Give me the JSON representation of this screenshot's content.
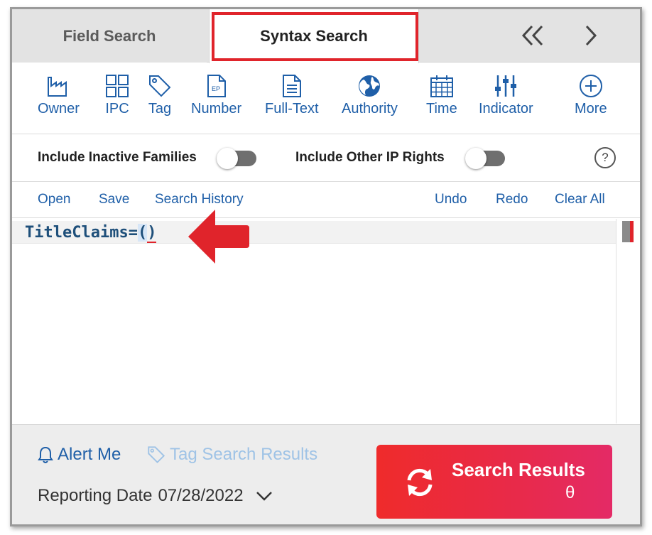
{
  "tabs": {
    "field_search": "Field Search",
    "syntax_search": "Syntax Search",
    "prev_icon": "double-chevron-left",
    "next_icon": "chevron-right"
  },
  "tools": [
    {
      "label": "Owner",
      "icon": "factory-icon"
    },
    {
      "label": "IPC",
      "icon": "grid-icon"
    },
    {
      "label": "Tag",
      "icon": "tag-icon"
    },
    {
      "label": "Number",
      "icon": "ep-document-icon"
    },
    {
      "label": "Full-Text",
      "icon": "document-icon"
    },
    {
      "label": "Authority",
      "icon": "globe-icon"
    },
    {
      "label": "Time",
      "icon": "calendar-icon"
    },
    {
      "label": "Indicator",
      "icon": "sliders-icon"
    },
    {
      "label": "More",
      "icon": "plus-circle-icon"
    }
  ],
  "toggles": {
    "inactive_families": {
      "label": "Include Inactive Families",
      "on": false
    },
    "other_ip_rights": {
      "label": "Include Other IP Rights",
      "on": false
    },
    "help": "?"
  },
  "actions": {
    "open": "Open",
    "save": "Save",
    "history": "Search History",
    "undo": "Undo",
    "redo": "Redo",
    "clear": "Clear All"
  },
  "editor": {
    "query_prefix": "TitleClaims=",
    "paren_open": "(",
    "paren_close": ")"
  },
  "footer": {
    "alert": "Alert Me",
    "tag_results": "Tag Search Results",
    "reporting_label": "Reporting Date",
    "reporting_date": "07/28/2022",
    "search_results": "Search Results",
    "theta": "θ"
  },
  "colors": {
    "accent_blue": "#1f5fa8",
    "highlight_red": "#e0242b",
    "button_gradient_start": "#ef2b2b",
    "button_gradient_end": "#e42a66"
  }
}
